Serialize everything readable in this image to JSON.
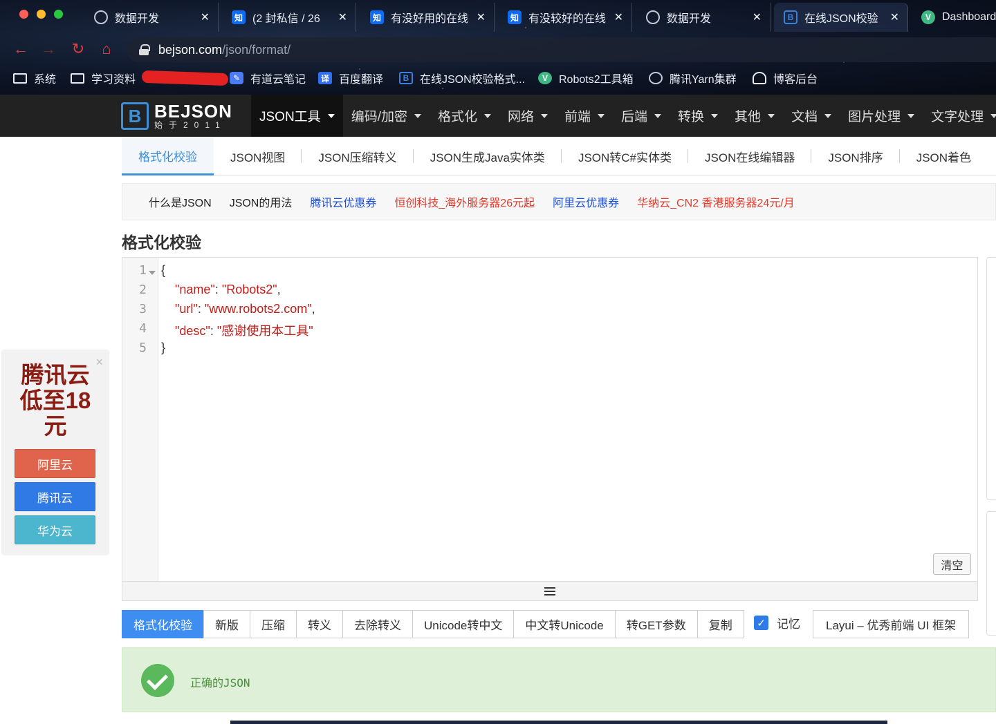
{
  "browser": {
    "tabs": [
      {
        "icon": "globe-icon",
        "glyph": "",
        "title": "数据开发"
      },
      {
        "icon": "zhihu-icon",
        "glyph": "知",
        "title": "(2 封私信 / 26"
      },
      {
        "icon": "zhihu-icon",
        "glyph": "知",
        "title": "有没好用的在线"
      },
      {
        "icon": "zhihu-icon",
        "glyph": "知",
        "title": "有没较好的在线"
      },
      {
        "icon": "globe-icon",
        "glyph": "",
        "title": "数据开发"
      },
      {
        "icon": "bejson-icon",
        "glyph": "B",
        "title": "在线JSON校验"
      },
      {
        "icon": "vue-icon",
        "glyph": "V",
        "title": "Dashboard"
      }
    ],
    "close_glyph": "✕",
    "back_glyph": "←",
    "forward_glyph": "→",
    "reload_glyph": "↻",
    "home_glyph": "⌂",
    "url_host": "bejson.com",
    "url_path": "/json/format/",
    "bookmarks": [
      {
        "icon": "folder-icon",
        "glyph": "",
        "label": "系统"
      },
      {
        "icon": "folder-icon",
        "glyph": "",
        "label": "学习资料"
      },
      {
        "icon": "note-icon",
        "glyph": "✎",
        "label": "有道云笔记"
      },
      {
        "icon": "translate-icon",
        "glyph": "译",
        "label": "百度翻译"
      },
      {
        "icon": "bejson-icon",
        "glyph": "B",
        "label": "在线JSON校验格式..."
      },
      {
        "icon": "vue-icon",
        "glyph": "V",
        "label": "Robots2工具箱"
      },
      {
        "icon": "globe-icon",
        "glyph": "",
        "label": "腾讯Yarn集群"
      },
      {
        "icon": "user-icon",
        "glyph": "",
        "label": "博客后台"
      }
    ]
  },
  "site": {
    "logo_mark": "B",
    "logo_brand": "BEJSON",
    "logo_since": "始于2011",
    "menu": [
      "JSON工具",
      "编码/加密",
      "格式化",
      "网络",
      "前端",
      "后端",
      "转换",
      "其他",
      "文档",
      "图片处理",
      "文字处理"
    ],
    "subtabs": [
      "格式化校验",
      "JSON视图",
      "JSON压缩转义",
      "JSON生成Java实体类",
      "JSON转C#实体类",
      "JSON在线编辑器",
      "JSON排序",
      "JSON着色"
    ],
    "links": [
      {
        "text": "什么是JSON",
        "color": "#222222"
      },
      {
        "text": "JSON的用法",
        "color": "#222222"
      },
      {
        "text": "腾讯云优惠券",
        "color": "#1a4fd6"
      },
      {
        "text": "恒创科技_海外服务器26元起",
        "color": "#e03a2b"
      },
      {
        "text": "阿里云优惠券",
        "color": "#1a4fd6"
      },
      {
        "text": "华纳云_CN2 香港服务器24元/月",
        "color": "#e03a2b"
      }
    ]
  },
  "page": {
    "title": "格式化校验",
    "clear_label": "清空",
    "buttons": [
      "格式化校验",
      "新版",
      "压缩",
      "转义",
      "去除转义",
      "Unicode转中文",
      "中文转Unicode",
      "转GET参数",
      "复制"
    ],
    "remember_label": "记忆",
    "remember_checked": true,
    "layui_label": "Layui – 优秀前端 UI 框架",
    "result_text": "正确的JSON"
  },
  "editor": {
    "line_numbers": [
      "1",
      "2",
      "3",
      "4",
      "5"
    ],
    "lines": [
      [
        {
          "t": "{",
          "c": "p"
        }
      ],
      [
        {
          "t": "    ",
          "c": "p"
        },
        {
          "t": "\"name\"",
          "c": "k"
        },
        {
          "t": ": ",
          "c": "p"
        },
        {
          "t": "\"Robots2\"",
          "c": "s"
        },
        {
          "t": ",",
          "c": "p"
        }
      ],
      [
        {
          "t": "    ",
          "c": "p"
        },
        {
          "t": "\"url\"",
          "c": "k"
        },
        {
          "t": ": ",
          "c": "p"
        },
        {
          "t": "\"www.robots2.com\"",
          "c": "s"
        },
        {
          "t": ",",
          "c": "p"
        }
      ],
      [
        {
          "t": "    ",
          "c": "p"
        },
        {
          "t": "\"desc\"",
          "c": "k"
        },
        {
          "t": ": ",
          "c": "p"
        },
        {
          "t": "\"感谢使用本工具\"",
          "c": "s"
        }
      ],
      [
        {
          "t": "}",
          "c": "p"
        }
      ]
    ]
  },
  "ad": {
    "close_glyph": "×",
    "title_lines": [
      "腾讯云",
      "低至18",
      "元"
    ],
    "buttons": [
      "阿里云",
      "腾讯云",
      "华为云"
    ]
  }
}
